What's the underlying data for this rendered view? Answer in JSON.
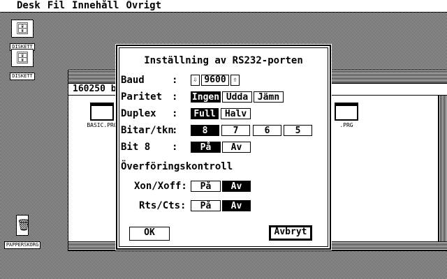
{
  "menubar": {
    "items": [
      "Desk",
      "Fil",
      "Innehåll",
      "Övrigt"
    ]
  },
  "desktop_icons": [
    {
      "label": "DISKETT",
      "glyph": "A"
    },
    {
      "label": "DISKETT",
      "glyph": "B"
    },
    {
      "label": "PAPPERSKORG",
      "glyph": "trash"
    }
  ],
  "window": {
    "info": "160250 b",
    "files": [
      "BASIC.PRG",
      ".PRG"
    ]
  },
  "dialog": {
    "title": "Inställning av RS232-porten",
    "baud": {
      "label": "Baud",
      "colon": ":",
      "value": "9600",
      "down_icon": "arrow-down-icon",
      "up_icon": "arrow-up-icon"
    },
    "parity": {
      "label": "Paritet",
      "colon": ":",
      "options": [
        "Ingen",
        "Udda",
        "Jämn"
      ],
      "selected": 0
    },
    "duplex": {
      "label": "Duplex",
      "colon": ":",
      "options": [
        "Full",
        "Halv"
      ],
      "selected": 0
    },
    "bits": {
      "label": "Bitar/tkn",
      "colon": ":",
      "options": [
        "8",
        "7",
        "6",
        "5"
      ],
      "selected": 0
    },
    "bit8": {
      "label": "Bit 8",
      "colon": ":",
      "options": [
        "På",
        "Av"
      ],
      "selected": 0
    },
    "flow_heading": "Överföringskontroll",
    "xon": {
      "label": "Xon/Xoff:",
      "options": [
        "På",
        "Av"
      ],
      "selected": 1
    },
    "rts": {
      "label": "Rts/Cts:",
      "options": [
        "På",
        "Av"
      ],
      "selected": 1
    },
    "ok_label": "OK",
    "cancel_label": "Avbryt"
  }
}
